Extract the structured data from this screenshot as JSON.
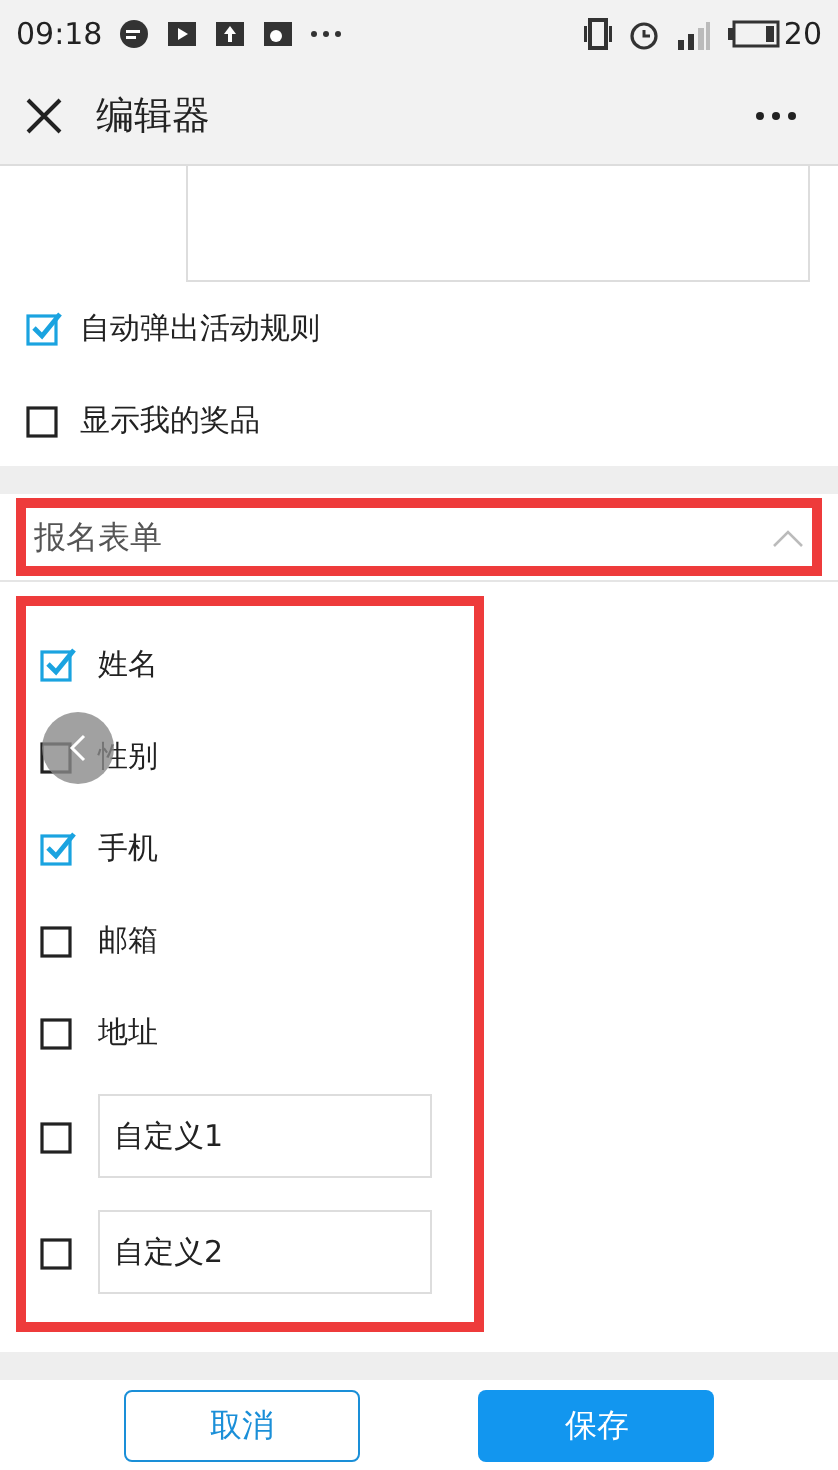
{
  "status_bar": {
    "time": "09:18",
    "battery": "20"
  },
  "header": {
    "title": "编辑器"
  },
  "options": [
    {
      "label": "自动弹出活动规则",
      "checked": true
    },
    {
      "label": "显示我的奖品",
      "checked": false
    }
  ],
  "section": {
    "title": "报名表单",
    "expanded": true,
    "highlighted": true
  },
  "fields": [
    {
      "kind": "check",
      "label": "姓名",
      "checked": true
    },
    {
      "kind": "check",
      "label": "性别",
      "checked": false
    },
    {
      "kind": "check",
      "label": "手机",
      "checked": true
    },
    {
      "kind": "check",
      "label": "邮箱",
      "checked": false
    },
    {
      "kind": "check",
      "label": "地址",
      "checked": false
    },
    {
      "kind": "input",
      "value": "自定义1",
      "checked": false
    },
    {
      "kind": "input",
      "value": "自定义2",
      "checked": false
    }
  ],
  "fields_highlighted": true,
  "buttons": {
    "cancel": "取消",
    "save": "保存"
  }
}
